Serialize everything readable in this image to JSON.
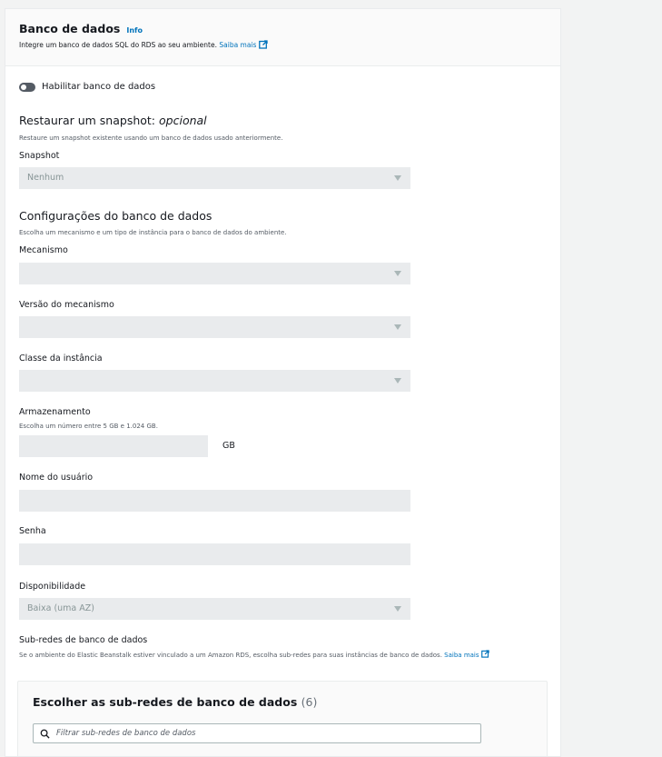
{
  "header": {
    "title": "Banco de dados",
    "info": "Info",
    "description": "Integre um banco de dados SQL do RDS ao seu ambiente.",
    "learn_more": "Saiba mais"
  },
  "toggle": {
    "label": "Habilitar banco de dados",
    "enabled": false
  },
  "snapshot_section": {
    "title": "Restaurar um snapshot:",
    "title_optional": "opcional",
    "description": "Restaure um snapshot existente usando um banco de dados usado anteriormente.",
    "field_label": "Snapshot",
    "value": "Nenhum"
  },
  "config_section": {
    "title": "Configurações do banco de dados",
    "description": "Escolha um mecanismo e um tipo de instância para o banco de dados do ambiente.",
    "engine_label": "Mecanismo",
    "engine_version_label": "Versão do mecanismo",
    "instance_class_label": "Classe da instância",
    "storage_label": "Armazenamento",
    "storage_hint": "Escolha um número entre 5 GB e 1.024 GB.",
    "storage_unit": "GB",
    "username_label": "Nome do usuário",
    "password_label": "Senha",
    "availability_label": "Disponibilidade",
    "availability_value": "Baixa (uma AZ)"
  },
  "subnets_section": {
    "title": "Sub-redes de banco de dados",
    "description": "Se o ambiente do Elastic Beanstalk estiver vinculado a um Amazon RDS, escolha sub-redes para suas instâncias de banco de dados.",
    "learn_more_1": "Saiba",
    "learn_more_2": "mais",
    "table_title": "Escolher as sub-redes de banco de dados",
    "count": "(6)",
    "filter_placeholder": "Filtrar sub-redes de banco de dados"
  }
}
